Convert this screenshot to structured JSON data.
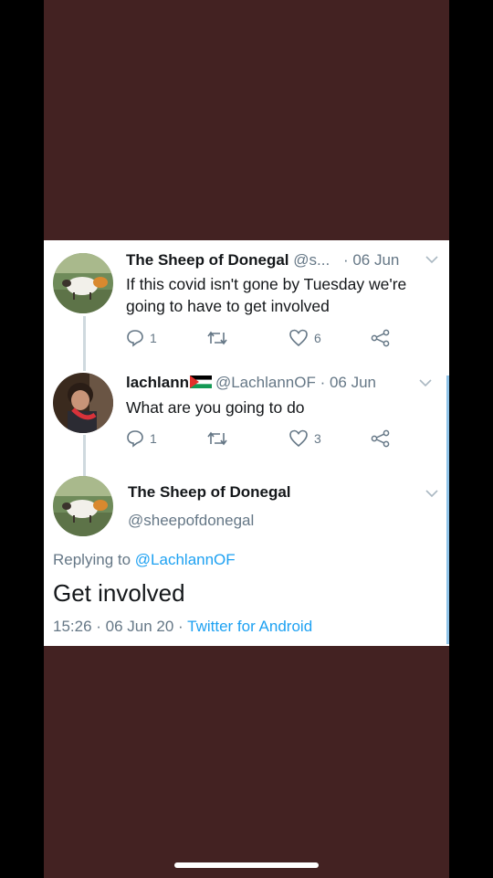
{
  "tweets": [
    {
      "name": "The Sheep of Donegal",
      "handle": "@s...",
      "date": "· 06 Jun",
      "text": "If this covid isn't gone by Tuesday we're going to have to get involved",
      "replies": "1",
      "retweets": "",
      "likes": "6"
    },
    {
      "name": "lachlann",
      "handle": "@LachlannOF",
      "date": "· 06 Jun",
      "text": "What are you going to do",
      "replies": "1",
      "retweets": "",
      "likes": "3"
    }
  ],
  "main_tweet": {
    "name": "The Sheep of Donegal",
    "handle": "@sheepofdonegal",
    "replying_label": "Replying to",
    "replying_to": "@LachlannOF",
    "text": "Get involved",
    "timestamp": "15:26 · 06 Jun 20 ·",
    "source": "Twitter for Android"
  },
  "icons": {
    "reply": "reply-icon",
    "retweet": "retweet-icon",
    "like": "heart-icon",
    "share": "share-icon",
    "flag": "palestine-flag-icon",
    "menu": "chevron-down-icon"
  },
  "colors": {
    "background": "#432222",
    "accent": "#1da1f2",
    "muted": "#657786"
  }
}
